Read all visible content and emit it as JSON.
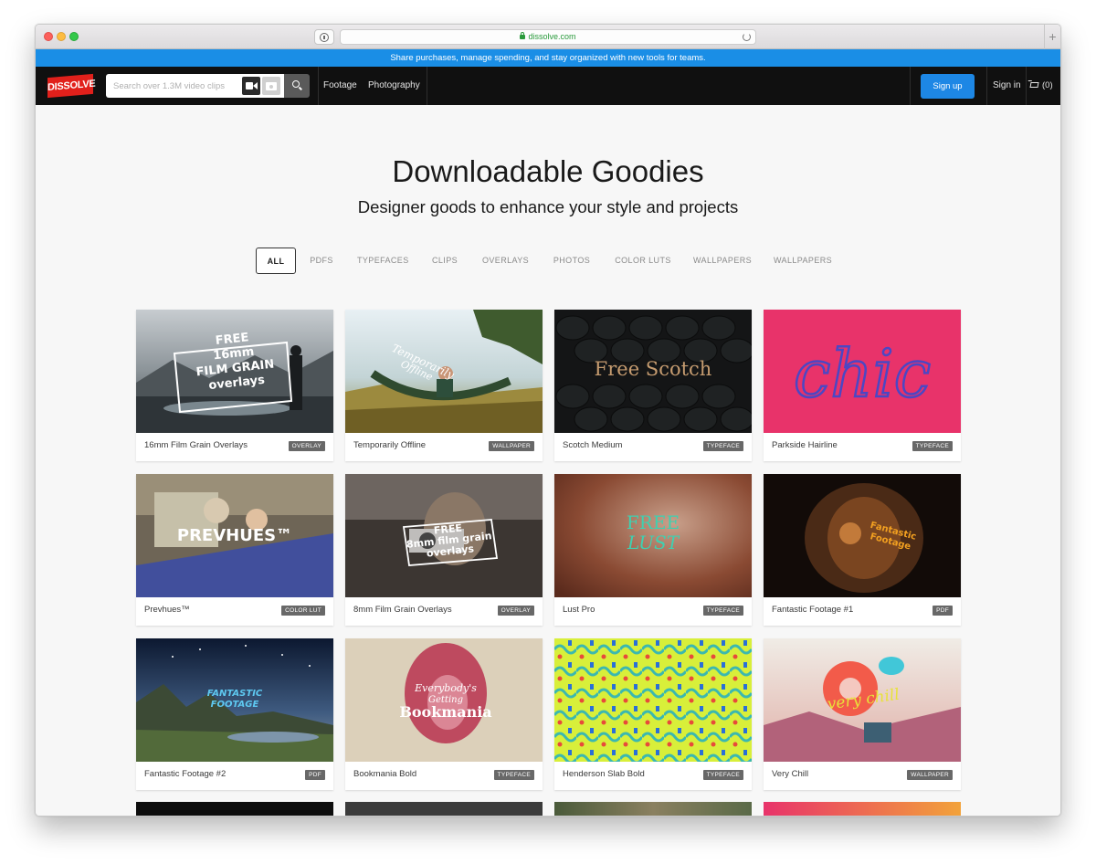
{
  "browser": {
    "url": "dissolve.com",
    "new_tab": "+"
  },
  "announcement": "Share purchases, manage spending, and stay organized with new tools for teams.",
  "nav": {
    "logo": "DISSOLVE",
    "search_placeholder": "Search over 1.3M video clips",
    "links": [
      "Footage",
      "Photography"
    ],
    "signup": "Sign up",
    "signin": "Sign in",
    "cart": "(0)"
  },
  "hero": {
    "title": "Downloadable Goodies",
    "subtitle": "Designer goods to enhance your style and projects"
  },
  "filters": [
    "ALL",
    "PDFS",
    "TYPEFACES",
    "CLIPS",
    "OVERLAYS",
    "PHOTOS",
    "COLOR LUTS",
    "WALLPAPERS",
    "WALLPAPERS"
  ],
  "active_filter": "ALL",
  "items": [
    {
      "name": "16mm Film Grain Overlays",
      "tag": "OVERLAY",
      "thumb_text": "FREE 16mm FILM GRAIN overlays"
    },
    {
      "name": "Temporarily Offline",
      "tag": "WALLPAPER",
      "thumb_text": "Temporarily Offline"
    },
    {
      "name": "Scotch Medium",
      "tag": "TYPEFACE",
      "thumb_text": "Free Scotch"
    },
    {
      "name": "Parkside Hairline",
      "tag": "TYPEFACE",
      "thumb_text": "chic"
    },
    {
      "name": "Prevhues™",
      "tag": "COLOR LUT",
      "thumb_text": "PREVHUES™"
    },
    {
      "name": "8mm Film Grain Overlays",
      "tag": "OVERLAY",
      "thumb_text": "FREE 8mm film grain overlays"
    },
    {
      "name": "Lust Pro",
      "tag": "TYPEFACE",
      "thumb_text": "FREE LUST"
    },
    {
      "name": "Fantastic Footage #1",
      "tag": "PDF",
      "thumb_text": "Fantastic Footage"
    },
    {
      "name": "Fantastic Footage #2",
      "tag": "PDF",
      "thumb_text": "FANTASTIC FOOTAGE"
    },
    {
      "name": "Bookmania Bold",
      "tag": "TYPEFACE",
      "thumb_text": "Everybody's Getting Bookmania"
    },
    {
      "name": "Henderson Slab Bold",
      "tag": "TYPEFACE",
      "thumb_text": ""
    },
    {
      "name": "Very Chill",
      "tag": "WALLPAPER",
      "thumb_text": "very chill"
    }
  ],
  "colors": {
    "announcement": "#1a8ee6",
    "nav_bg": "#101010",
    "logo_red": "#e1201b",
    "signup_blue": "#1d87e5"
  }
}
